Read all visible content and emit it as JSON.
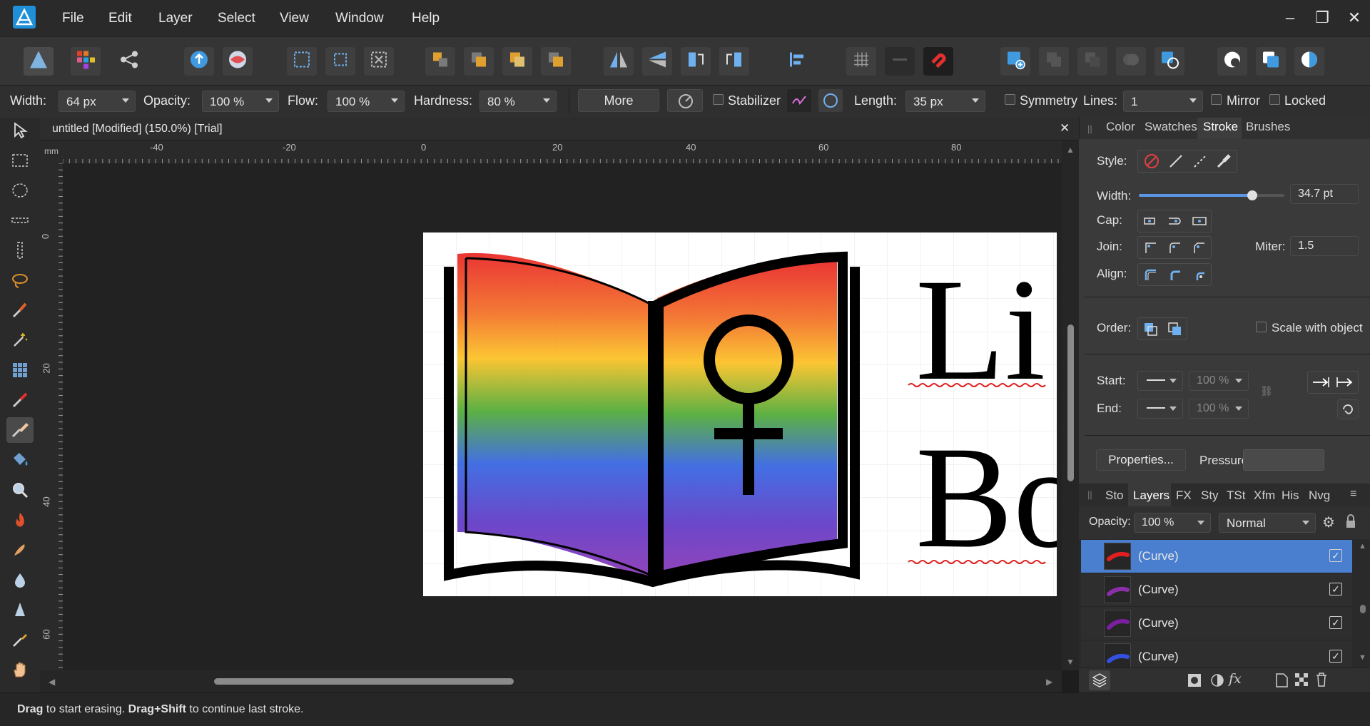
{
  "menu": {
    "items": [
      "File",
      "Edit",
      "Layer",
      "Select",
      "View",
      "Window",
      "Help"
    ]
  },
  "window_controls": {
    "minimize": "–",
    "restore": "❐",
    "close": "✕"
  },
  "context_toolbar": {
    "width_label": "Width:",
    "width_value": "64 px",
    "opacity_label": "Opacity:",
    "opacity_value": "100 %",
    "flow_label": "Flow:",
    "flow_value": "100 %",
    "hardness_label": "Hardness:",
    "hardness_value": "80 %",
    "more_label": "More",
    "stabilizer_label": "Stabilizer",
    "length_label": "Length:",
    "length_value": "35 px",
    "symmetry_label": "Symmetry",
    "lines_label": "Lines:",
    "lines_value": "1",
    "mirror_label": "Mirror",
    "locked_label": "Locked"
  },
  "document": {
    "title": "untitled [Modified] (150.0%) [Trial]",
    "close": "✕",
    "unit": "mm"
  },
  "ruler_top": [
    "-40",
    "-20",
    "0",
    "20",
    "40",
    "60",
    "80"
  ],
  "ruler_left": [
    "0",
    "20",
    "40",
    "60"
  ],
  "artwork": {
    "line1": "Li",
    "line2": "Bo"
  },
  "stroke_panel": {
    "tabs": [
      "Color",
      "Swatches",
      "Stroke",
      "Brushes"
    ],
    "active_tab": "Stroke",
    "style_label": "Style:",
    "width_label": "Width:",
    "width_value": "34.7 pt",
    "width_slider": 0.78,
    "cap_label": "Cap:",
    "join_label": "Join:",
    "miter_label": "Miter:",
    "miter_value": "1.5",
    "align_label": "Align:",
    "order_label": "Order:",
    "scale_label": "Scale with object",
    "start_label": "Start:",
    "start_value": "100 %",
    "end_label": "End:",
    "end_value": "100 %",
    "properties_label": "Properties...",
    "pressure_label": "Pressure:"
  },
  "layers_panel": {
    "tabs": [
      "Sto",
      "Layers",
      "FX",
      "Sty",
      "TSt",
      "Xfm",
      "His",
      "Nvg"
    ],
    "active_tab": "Layers",
    "opacity_label": "Opacity:",
    "opacity_value": "100 %",
    "blend_value": "Normal",
    "layers": [
      {
        "name": "(Curve)",
        "color": "#e02020",
        "selected": true
      },
      {
        "name": "(Curve)",
        "color": "#8a2fa8",
        "selected": false
      },
      {
        "name": "(Curve)",
        "color": "#7a1fa0",
        "selected": false
      },
      {
        "name": "(Curve)",
        "color": "#3450e0",
        "selected": false
      }
    ]
  },
  "status": {
    "bold1": "Drag",
    "text1": " to start erasing. ",
    "bold2": "Drag",
    "plus": "+",
    "bold3": "Shift",
    "text2": " to continue last stroke."
  }
}
